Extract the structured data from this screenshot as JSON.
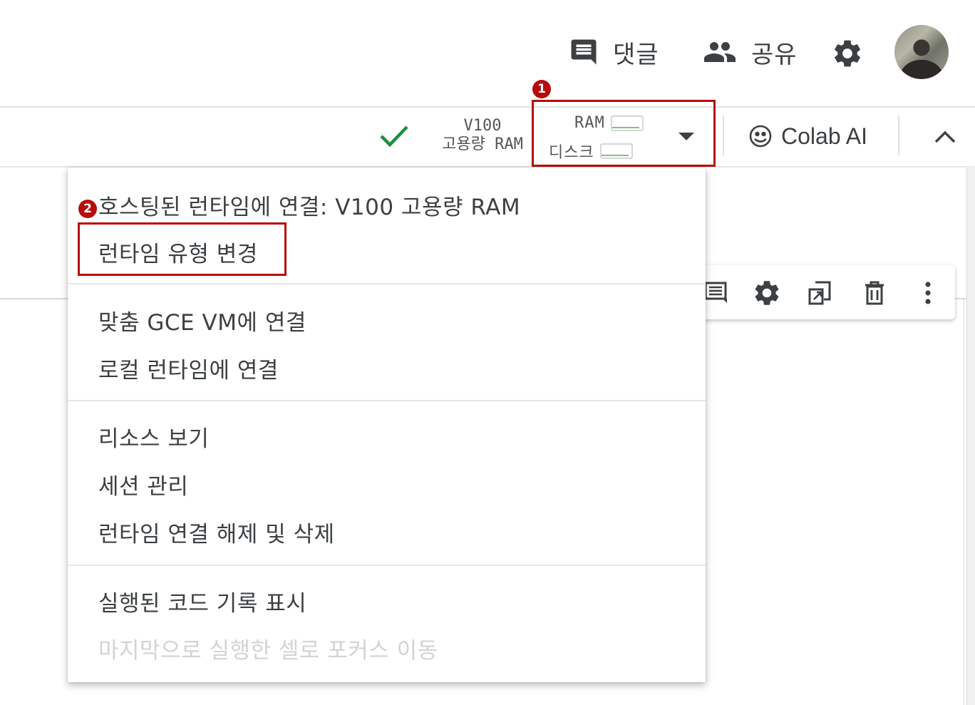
{
  "header": {
    "comments_label": "댓글",
    "share_label": "공유",
    "settings_icon": "gear-icon",
    "avatar_icon": "user-avatar"
  },
  "toolbar": {
    "status_icon": "checkmark-icon",
    "status_color": "#1e8e3e",
    "machine_gpu": "V100",
    "machine_ram": "고용량 RAM",
    "ram_label": "RAM",
    "disk_label": "디스크",
    "ram_usage_fraction": 0.02,
    "disk_usage_fraction": 0.02,
    "dropdown_icon": "caret-down-icon",
    "colab_ai_label": "Colab AI",
    "collapse_icon": "chevron-up-icon"
  },
  "annotations": {
    "badge_1": "1",
    "badge_2": "2",
    "highlight_color": "#b50d0d"
  },
  "menu": {
    "items": [
      {
        "label": "호스팅된 런타임에 연결: V100 고용량 RAM",
        "enabled": true
      },
      {
        "label": "런타임 유형 변경",
        "enabled": true
      },
      {
        "label": "맞춤 GCE VM에 연결",
        "enabled": true
      },
      {
        "label": "로컬 런타임에 연결",
        "enabled": true
      },
      {
        "label": "리소스 보기",
        "enabled": true
      },
      {
        "label": "세션 관리",
        "enabled": true
      },
      {
        "label": "런타임 연결 해제 및 삭제",
        "enabled": true
      },
      {
        "label": "실행된 코드 기록 표시",
        "enabled": true
      },
      {
        "label": "마지막으로 실행한 셀로 포커스 이동",
        "enabled": false
      }
    ]
  },
  "cell_toolbar": {
    "icons": [
      "comment-icon",
      "gear-icon",
      "mirror-cell-icon",
      "delete-icon",
      "more-vert-icon"
    ]
  }
}
